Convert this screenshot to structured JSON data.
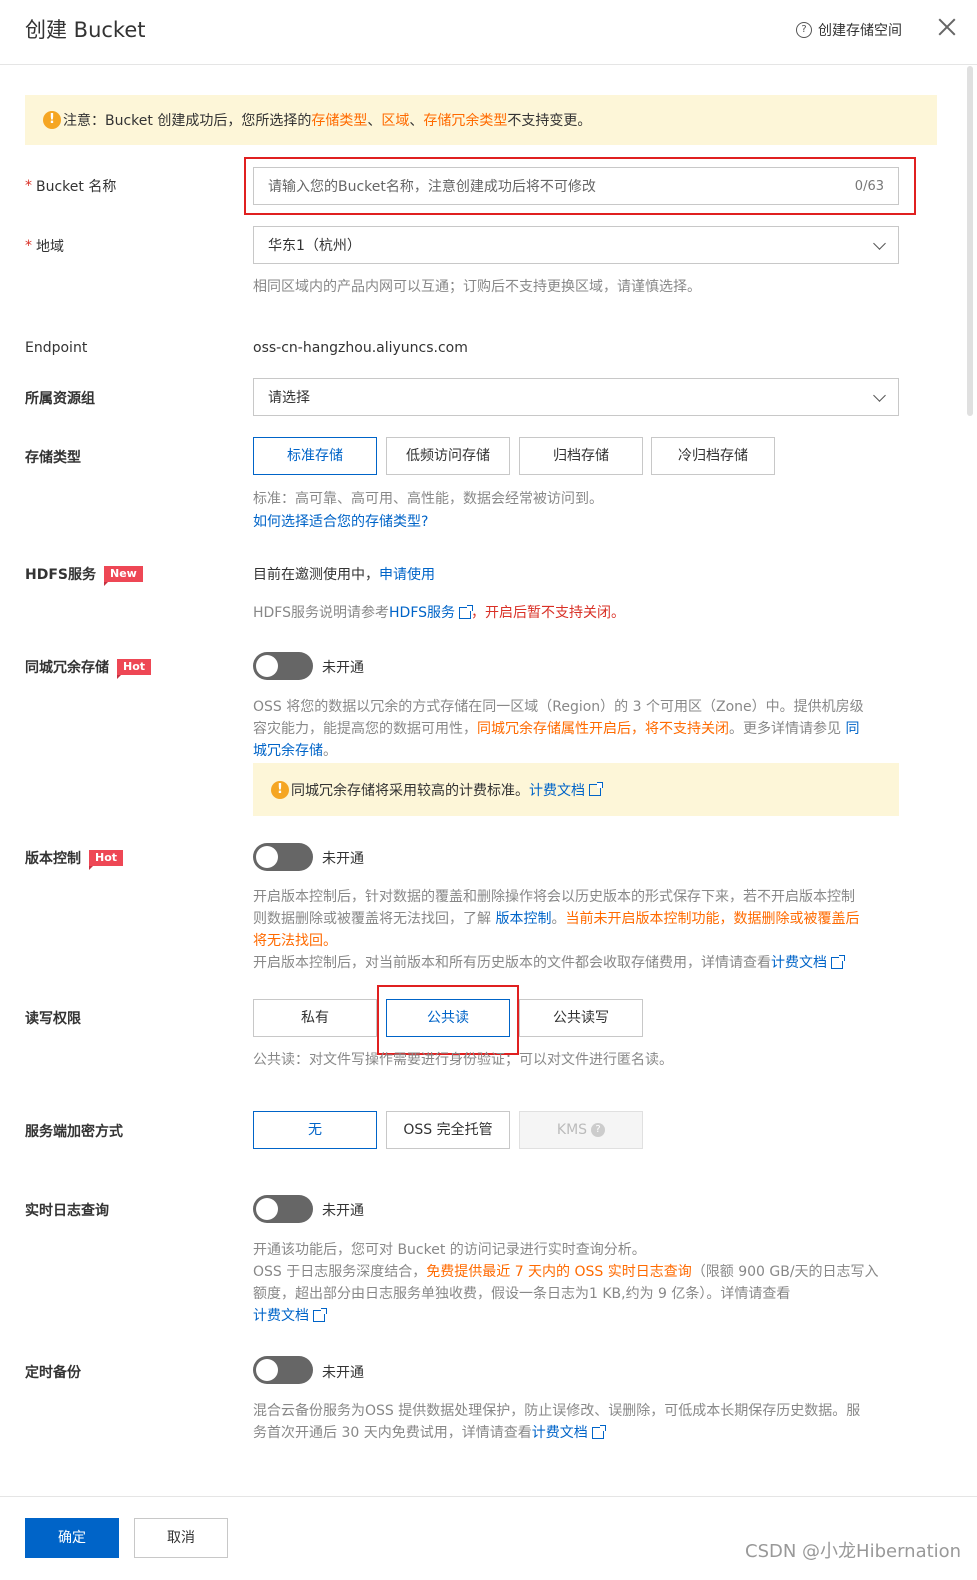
{
  "header": {
    "title": "创建 Bucket",
    "help_label": "创建存储空间",
    "help_icon": "question-circle-icon",
    "close_icon": "close-icon"
  },
  "notice": {
    "icon": "warning-icon",
    "prefix": "注意：Bucket 创建成功后，您所选择的 ",
    "link1": "存储类型",
    "sep1": "、",
    "link2": "区域",
    "sep2": "、",
    "link3": "存储冗余类型",
    "suffix": " 不支持变更。"
  },
  "bucket_name": {
    "required_mark": "*",
    "label": "Bucket 名称",
    "placeholder": "请输入您的Bucket名称，注意创建成功后将不可修改",
    "count": "0/63"
  },
  "region": {
    "required_mark": "*",
    "label": "地域",
    "value": "华东1（杭州）",
    "help": "相同区域内的产品内网可以互通；订购后不支持更换区域，请谨慎选择。"
  },
  "endpoint": {
    "label": "Endpoint",
    "value": "oss-cn-hangzhou.aliyuncs.com"
  },
  "resource_group": {
    "label": "所属资源组",
    "placeholder": "请选择"
  },
  "storage_class": {
    "label": "存储类型",
    "options": [
      "标准存储",
      "低频访问存储",
      "归档存储",
      "冷归档存储"
    ],
    "help": "标准：高可靠、高可用、高性能，数据会经常被访问到。",
    "link": "如何选择适合您的存储类型?"
  },
  "hdfs": {
    "label": "HDFS服务",
    "badge": "New",
    "status_text": "目前在邀测使用中，",
    "apply_link": "申请使用",
    "help_prefix": "HDFS服务说明请参考",
    "help_link": "HDFS服务",
    "help_suffix": "，开启后暂不支持关闭。"
  },
  "zrs": {
    "label": "同城冗余存储",
    "badge": "Hot",
    "toggle_label": "未开通",
    "help_line1": "OSS 将您的数据以冗余的方式存储在同一区域（Region）的 3 个可用区（Zone）中。提供机房级",
    "help_line2_a": "容灾能力，能提高您的数据可用性，",
    "help_line2_b": "同城冗余存储属性开启后，将不支持关闭",
    "help_line2_c": "。更多详情请参见 ",
    "help_line2_link": "同",
    "help_line3_link": "城冗余存储",
    "help_line3_end": "。",
    "notice_text": "同城冗余存储将采用较高的计费标准。",
    "notice_link": "计费文档"
  },
  "versioning": {
    "label": "版本控制",
    "badge": "Hot",
    "toggle_label": "未开通",
    "help_line1": "开启版本控制后，针对数据的覆盖和删除操作将会以历史版本的形式保存下来，若不开启版本控制",
    "help_line2_a": "则数据删除或被覆盖将无法找回，了解 ",
    "help_line2_link": "版本控制",
    "help_line2_b": "。",
    "help_line2_warn": "当前未开启版本控制功能，数据删除或被覆盖后",
    "help_line3_warn": "将无法找回。",
    "help_line4": "开启版本控制后，对当前版本和所有历史版本的文件都会收取存储费用，详情请查看",
    "help_line4_link": "计费文档"
  },
  "acl": {
    "label": "读写权限",
    "options": [
      "私有",
      "公共读",
      "公共读写"
    ],
    "help": "公共读：对文件写操作需要进行身份验证；可以对文件进行匿名读。"
  },
  "encryption": {
    "label": "服务端加密方式",
    "options": [
      "无",
      "OSS 完全托管",
      "KMS"
    ]
  },
  "realtime_log": {
    "label": "实时日志查询",
    "toggle_label": "未开通",
    "help_line1": "开通该功能后，您可对 Bucket 的访问记录进行实时查询分析。",
    "help_line2_a": "OSS 于日志服务深度结合，",
    "help_line2_b": "免费提供最近 7 天内的 OSS 实时日志查询",
    "help_line2_c": "（限额 900 GB/天的日志写入",
    "help_line3": "额度，超出部分由日志服务单独收费，假设一条日志为1 KB,约为 9 亿条）。详情请查看",
    "help_line4_link": "计费文档"
  },
  "backup": {
    "label": "定时备份",
    "toggle_label": "未开通",
    "help_line1": "混合云备份服务为OSS 提供数据处理保护，防止误修改、误删除，可低成本长期保存历史数据。服",
    "help_line2": "务首次开通后 30 天内免费试用，详情请查看",
    "help_line2_link": "计费文档"
  },
  "footer": {
    "confirm": "确定",
    "cancel": "取消",
    "watermark": "CSDN @小龙Hibernation"
  }
}
